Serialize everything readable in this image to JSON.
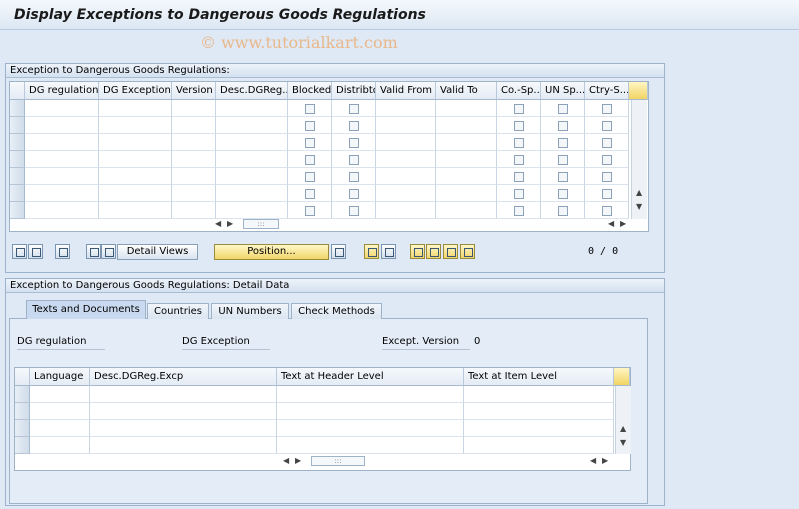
{
  "title": "Display Exceptions to Dangerous Goods Regulations",
  "watermark": "© www.tutorialkart.com",
  "table1": {
    "group_title": "Exception to Dangerous Goods Regulations:",
    "columns": [
      "DG regulation",
      "DG Exception",
      "Version",
      "Desc.DGReg....",
      "Blocked",
      "Distribtd",
      "Valid From",
      "Valid To",
      "Co.-Sp...",
      "UN Sp...",
      "Ctry-S..."
    ],
    "row_count": 7,
    "counter": "0 / 0"
  },
  "toolbar": {
    "detail_views_label": "Detail Views",
    "position_label": "Position..."
  },
  "detail": {
    "group_title": "Exception to Dangerous Goods Regulations: Detail Data",
    "tabs": [
      "Texts and Documents",
      "Countries",
      "UN Numbers",
      "Check Methods"
    ],
    "dg_regulation_label": "DG regulation",
    "dg_exception_label": "DG Exception",
    "except_version_label": "Except. Version",
    "except_version_value": "0",
    "text_table": {
      "columns": [
        "Language",
        "Desc.DGReg.Excp",
        "Text at Header Level",
        "Text at Item Level"
      ],
      "row_count": 4
    }
  },
  "scroll_thumb": ":::"
}
